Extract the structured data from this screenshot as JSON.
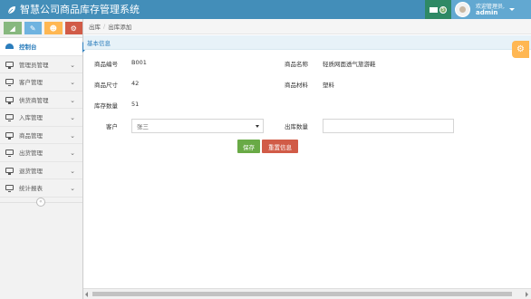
{
  "app": {
    "title": "智慧公司商品库存管理系统"
  },
  "header": {
    "mail_count": "5",
    "welcome": "欢迎管理员,",
    "username": "admin"
  },
  "sidebar": {
    "items": [
      {
        "label": "控制台",
        "active": true
      },
      {
        "label": "管理员管理"
      },
      {
        "label": "客户管理"
      },
      {
        "label": "供货商管理"
      },
      {
        "label": "入库管理"
      },
      {
        "label": "商品管理"
      },
      {
        "label": "出货管理"
      },
      {
        "label": "退货管理"
      },
      {
        "label": "统计报表"
      }
    ]
  },
  "breadcrumb": {
    "first": "出库",
    "second": "出库添加"
  },
  "section": {
    "title": "基本信息"
  },
  "form": {
    "code_label": "商品编号",
    "code_value": "B001",
    "name_label": "商品名称",
    "name_value": "轻质网面透气旅游鞋",
    "size_label": "商品尺寸",
    "size_value": "42",
    "material_label": "商品材料",
    "material_value": "塑料",
    "stock_label": "库存数量",
    "stock_value": "51",
    "customer_label": "客户",
    "customer_selected": "张三",
    "qty_label": "出库数量",
    "qty_value": "",
    "save_label": "保存",
    "reset_label": "重置信息"
  },
  "colors": {
    "header": "#438eb9",
    "save": "#69aa46",
    "reset": "#d15b47",
    "settings": "#ffb752"
  }
}
